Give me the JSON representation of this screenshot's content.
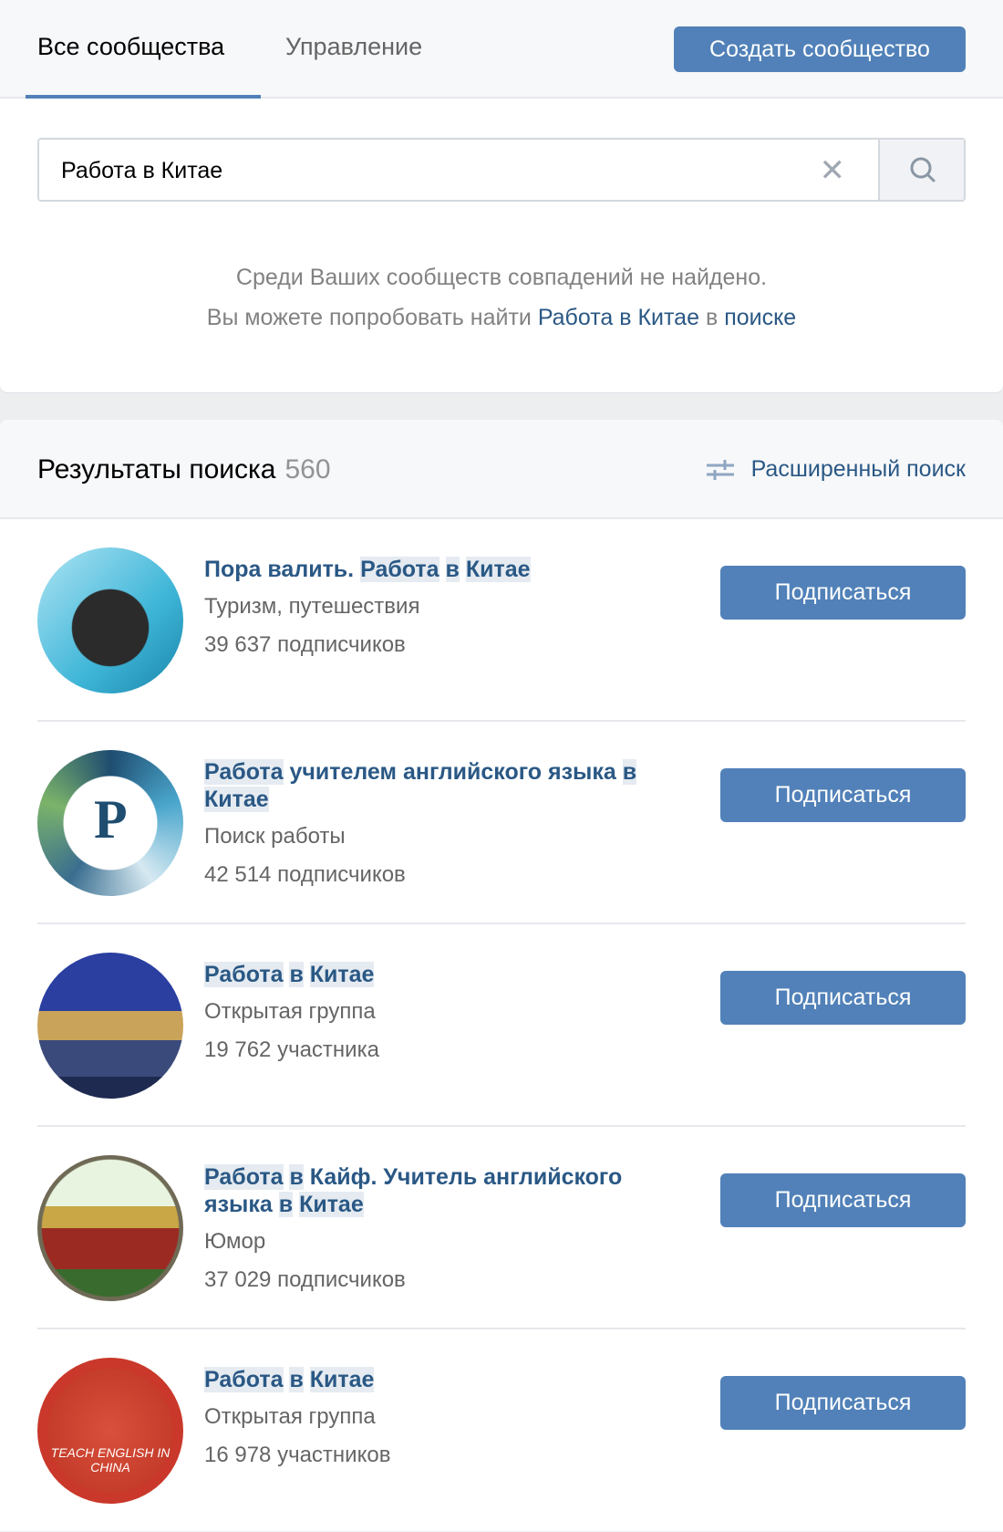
{
  "tabs": [
    {
      "label": "Все сообщества",
      "active": true
    },
    {
      "label": "Управление",
      "active": false
    }
  ],
  "create_button": "Создать сообщество",
  "search": {
    "value": "Работа в Китае",
    "clear_icon": "close-icon",
    "search_icon": "search-icon"
  },
  "empty_message": {
    "line1": "Среди Ваших сообществ совпадений не найдено.",
    "line2_prefix": "Вы можете попробовать найти ",
    "line2_link": "Работа в Китае",
    "line2_mid": " в ",
    "line2_link2": "поиске"
  },
  "results": {
    "title": "Результаты поиска",
    "count": "560",
    "advanced_search": "Расширенный поиск"
  },
  "colors": {
    "accent": "#5181b8",
    "link": "#2a5885",
    "highlight": "#e5ebf1"
  },
  "items": [
    {
      "title": [
        {
          "t": "Пора ",
          "hl": false
        },
        {
          "t": "валить.",
          "hl": false
        },
        {
          "t": " ",
          "hl": false
        },
        {
          "t": "Работа",
          "hl": true
        },
        {
          "t": " ",
          "hl": false
        },
        {
          "t": "в",
          "hl": true
        },
        {
          "t": " ",
          "hl": false
        },
        {
          "t": "Китае",
          "hl": true
        }
      ],
      "category": "Туризм, путешествия",
      "members": "39 637 подписчиков",
      "button": "Подписаться"
    },
    {
      "title": [
        {
          "t": "Работа",
          "hl": true
        },
        {
          "t": " учителем английского языка ",
          "hl": false
        },
        {
          "t": "в",
          "hl": true
        },
        {
          "t": " ",
          "hl": false
        },
        {
          "t": "Китае",
          "hl": true
        }
      ],
      "category": "Поиск работы",
      "members": "42 514 подписчиков",
      "button": "Подписаться"
    },
    {
      "title": [
        {
          "t": "Работа",
          "hl": true
        },
        {
          "t": " ",
          "hl": false
        },
        {
          "t": "в",
          "hl": true
        },
        {
          "t": " ",
          "hl": false
        },
        {
          "t": "Китае",
          "hl": true
        }
      ],
      "category": "Открытая группа",
      "members": "19 762 участника",
      "button": "Подписаться"
    },
    {
      "title": [
        {
          "t": "Работа",
          "hl": true
        },
        {
          "t": " ",
          "hl": false
        },
        {
          "t": "в",
          "hl": true
        },
        {
          "t": " Кайф. Учитель английского языка ",
          "hl": false
        },
        {
          "t": "в",
          "hl": true
        },
        {
          "t": " ",
          "hl": false
        },
        {
          "t": "Китае",
          "hl": true
        }
      ],
      "category": "Юмор",
      "members": "37 029 подписчиков",
      "button": "Подписаться"
    },
    {
      "title": [
        {
          "t": "Работа",
          "hl": true
        },
        {
          "t": " ",
          "hl": false
        },
        {
          "t": "в",
          "hl": true
        },
        {
          "t": " ",
          "hl": false
        },
        {
          "t": "Китае",
          "hl": true
        }
      ],
      "category": "Открытая группа",
      "members": "16 978 участников",
      "button": "Подписаться",
      "avatar_text": "TEACH ENGLISH IN CHINA"
    }
  ]
}
